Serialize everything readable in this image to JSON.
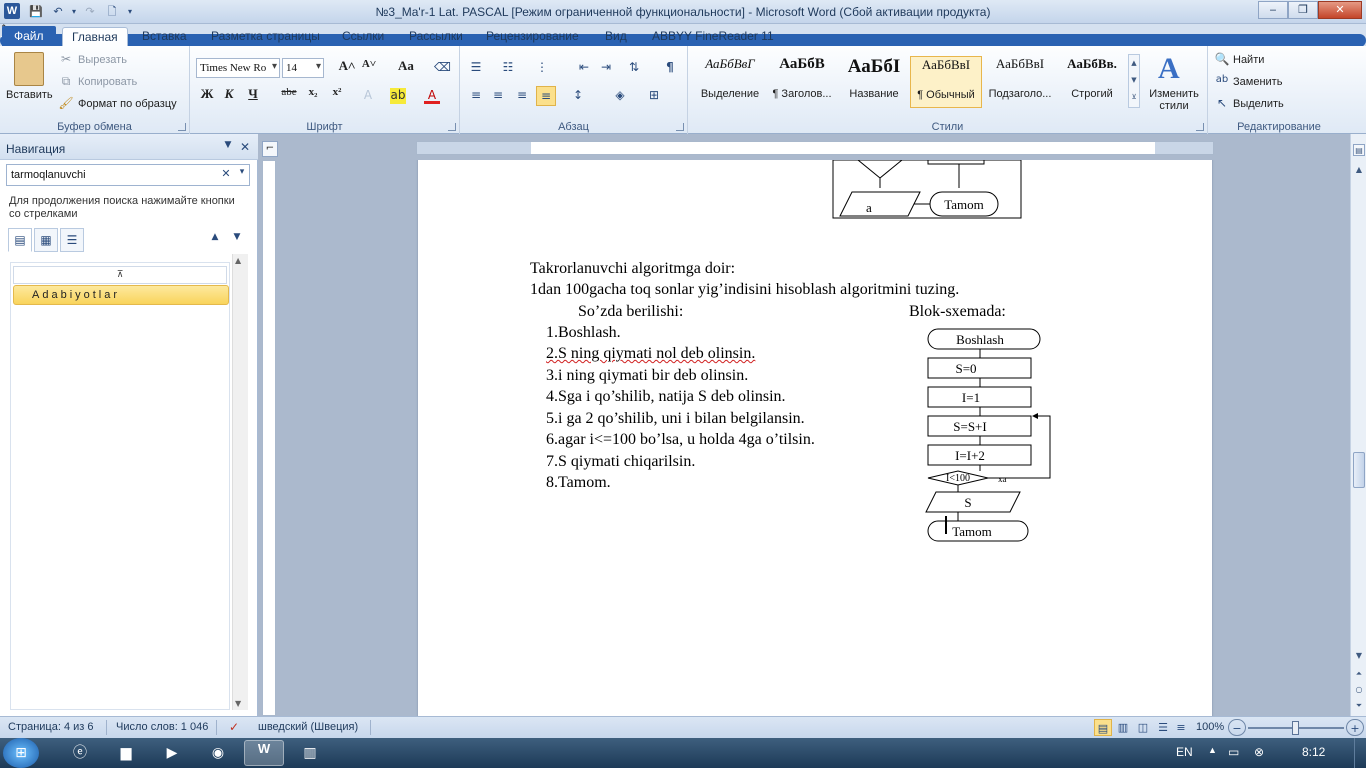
{
  "window": {
    "title": "№3_Ma'r-1 Lat. PASCAL [Режим ограниченной функциональности]  -  Microsoft Word (Сбой активации продукта)",
    "app_icon": "W"
  },
  "quick_access": [
    "save-icon",
    "undo-icon",
    "redo-icon",
    "new-doc-icon"
  ],
  "tabs": [
    "Файл",
    "Главная",
    "Вставка",
    "Разметка страницы",
    "Ссылки",
    "Рассылки",
    "Рецензирование",
    "Вид",
    "ABBYY FineReader 11"
  ],
  "ribbon": {
    "clipboard": {
      "label": "Буфер обмена",
      "paste": "Вставить",
      "cut": "Вырезать",
      "copy": "Копировать",
      "format_painter": "Формат по образцу"
    },
    "font": {
      "label": "Шрифт",
      "font_name": "Times New Ro",
      "font_size": "14",
      "bold": "Ж",
      "italic": "К",
      "underline": "Ч",
      "strike": "abe",
      "subscript": "x₂",
      "superscript": "x²",
      "grow": "A˄",
      "shrink": "A˅",
      "case": "Aa"
    },
    "paragraph": {
      "label": "Абзац",
      "pilcrow": "¶"
    },
    "styles": {
      "label": "Стили",
      "items": [
        {
          "sample": "АаБбВвГ",
          "name": "Выделение"
        },
        {
          "sample": "АаБбВ",
          "name": "¶ Заголов..."
        },
        {
          "sample": "АаБбІ",
          "name": "Название"
        },
        {
          "sample": "АаБбВвІ",
          "name": "¶ Обычный"
        },
        {
          "sample": "АаБбВвІ",
          "name": "Подзаголо..."
        },
        {
          "sample": "АаБбВв.",
          "name": "Строгий"
        }
      ],
      "change_styles": "Изменить стили"
    },
    "editing": {
      "label": "Редактирование",
      "find": "Найти",
      "replace": "Заменить",
      "select": "Выделить"
    }
  },
  "navigation": {
    "title": "Навигация",
    "search_value": "tarmoqlanuvchi",
    "hint": "Для продолжения поиска нажимайте кнопки со стрелками",
    "heading_result": "Adabiyotlar"
  },
  "document": {
    "top_flowchart": {
      "left_label": "a",
      "right_label": "Tamom"
    },
    "heading": "Takrorlanuvchi  algoritmga  doir:",
    "task": "1dan 100gacha toq sonlar yig’indisini  hisoblash algoritmini  tuzing.",
    "col_left": "So’zda berilishi:",
    "col_right": "Blok-sxemada:",
    "steps": [
      "1.Boshlash.",
      "2.S ning qiymati  nol deb olinsin.",
      "3.i ning  qiymati  bir  deb olinsin.",
      "4.Sga i qo’shilib, natija  S deb olinsin.",
      "5.i ga 2 qo’shilib, uni i bilan  belgilansin.",
      "6.agar i<=100  bo’lsa, u holda 4ga o’tilsin.",
      "7.S  qiymati  chiqarilsin.",
      "8.Tamom."
    ],
    "flowchart": {
      "start": "Boshlash",
      "s_init": "S=0",
      "i_init": "I=1",
      "accumulate": "S=S+I",
      "increment": "I=I+2",
      "condition": "I<100",
      "yes": "xa",
      "output": "S",
      "end": "Tamom"
    }
  },
  "status": {
    "page": "Страница: 4 из 6",
    "words": "Число слов: 1 046",
    "language": "шведский (Швеция)",
    "zoom": "100%"
  },
  "tray": {
    "lang": "EN",
    "time": "8:12"
  }
}
